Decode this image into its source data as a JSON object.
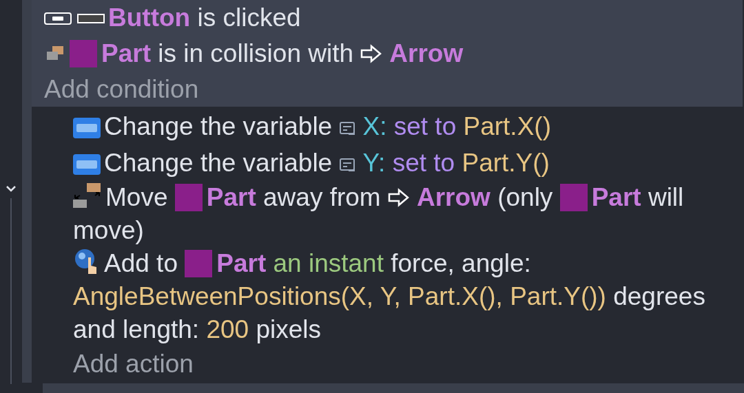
{
  "toggle": {
    "expanded": true
  },
  "conditions": [
    {
      "segments": [
        {
          "kind": "button",
          "text": "Button"
        },
        {
          "kind": "text",
          "text": "is clicked"
        }
      ]
    },
    {
      "segments": [
        {
          "kind": "sprite",
          "text": "Part"
        },
        {
          "kind": "text",
          "text": "is in collision with"
        },
        {
          "kind": "shape",
          "text": "Arrow"
        }
      ]
    }
  ],
  "add_condition": "Add condition",
  "actions": [
    {
      "segments": [
        {
          "kind": "text",
          "text": "Change the variable"
        },
        {
          "kind": "variable",
          "text": "X:"
        },
        {
          "kind": "operator",
          "text": "set to"
        },
        {
          "kind": "value",
          "text": "Part.X()"
        }
      ]
    },
    {
      "segments": [
        {
          "kind": "text",
          "text": "Change the variable"
        },
        {
          "kind": "variable",
          "text": "Y:"
        },
        {
          "kind": "operator",
          "text": "set to"
        },
        {
          "kind": "value",
          "text": "Part.Y()"
        }
      ]
    },
    {
      "segments": [
        {
          "kind": "text",
          "text": "Move"
        },
        {
          "kind": "sprite",
          "text": "Part"
        },
        {
          "kind": "text",
          "text": "away from"
        },
        {
          "kind": "shape",
          "text": "Arrow"
        },
        {
          "kind": "text",
          "text": "(only"
        },
        {
          "kind": "sprite",
          "text": "Part"
        },
        {
          "kind": "text",
          "text": "will move)"
        }
      ]
    },
    {
      "segments": [
        {
          "kind": "text",
          "text": "Add to"
        },
        {
          "kind": "sprite",
          "text": "Part"
        },
        {
          "kind": "param",
          "text": "an instant"
        },
        {
          "kind": "text",
          "text": "force, angle:"
        },
        {
          "kind": "value",
          "text": "AngleBetweenPositions(X, Y, Part.X(), Part.Y())"
        },
        {
          "kind": "text",
          "text": "degrees and length:"
        },
        {
          "kind": "value",
          "text": "200"
        },
        {
          "kind": "text",
          "text": "pixels"
        }
      ]
    }
  ],
  "add_action": "Add action"
}
